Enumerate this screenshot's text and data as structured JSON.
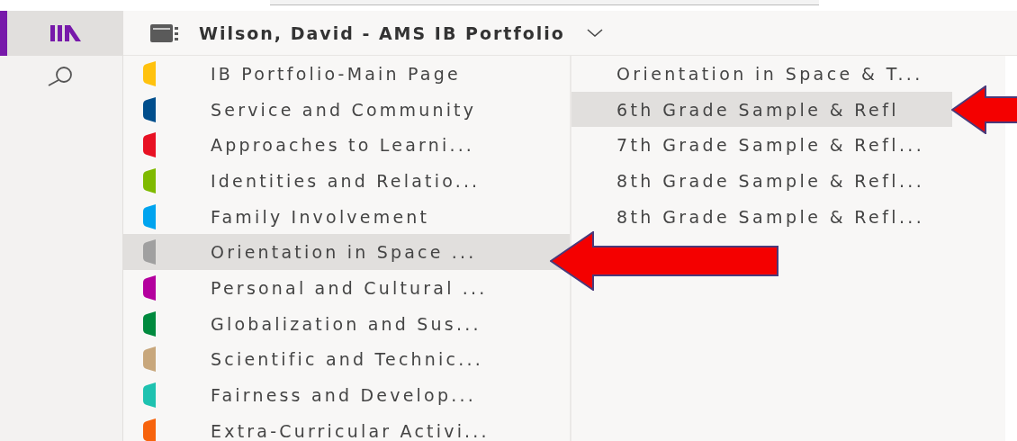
{
  "notebook": {
    "title": "Wilson, David - AMS IB Portfolio"
  },
  "sections": [
    {
      "name": "IB Portfolio-Main Page",
      "color": "#ffc20e",
      "selected": false,
      "marked": false
    },
    {
      "name": "Service and Community",
      "color": "#004e8c",
      "selected": false,
      "marked": false
    },
    {
      "name": "Approaches to Learni...",
      "color": "#e81123",
      "selected": false,
      "marked": false
    },
    {
      "name": "Identities and Relatio...",
      "color": "#7fba00",
      "selected": false,
      "marked": false
    },
    {
      "name": "Family Involvement",
      "color": "#00a4ef",
      "selected": false,
      "marked": false
    },
    {
      "name": "Orientation in Space ...",
      "color": "#a0a0a0",
      "selected": true,
      "marked": true
    },
    {
      "name": "Personal and Cultural ...",
      "color": "#b4009e",
      "selected": false,
      "marked": false
    },
    {
      "name": "Globalization and Sus...",
      "color": "#008a3e",
      "selected": false,
      "marked": false
    },
    {
      "name": "Scientific and Technic...",
      "color": "#c8a77c",
      "selected": false,
      "marked": false
    },
    {
      "name": "Fairness and Develop...",
      "color": "#1ec2b0",
      "selected": false,
      "marked": false
    },
    {
      "name": "Extra-Curricular Activi...",
      "color": "#f7630c",
      "selected": false,
      "marked": false
    }
  ],
  "pages": [
    {
      "title": "Orientation in Space & T...",
      "selected": false,
      "marked": false
    },
    {
      "title": "6th Grade Sample & Refl",
      "selected": true,
      "marked": true
    },
    {
      "title": "7th Grade Sample & Refl...",
      "selected": false,
      "marked": false
    },
    {
      "title": "8th Grade Sample & Refl...",
      "selected": false,
      "marked": false
    },
    {
      "title": "8th Grade Sample & Refl...",
      "selected": false,
      "marked": false
    }
  ]
}
